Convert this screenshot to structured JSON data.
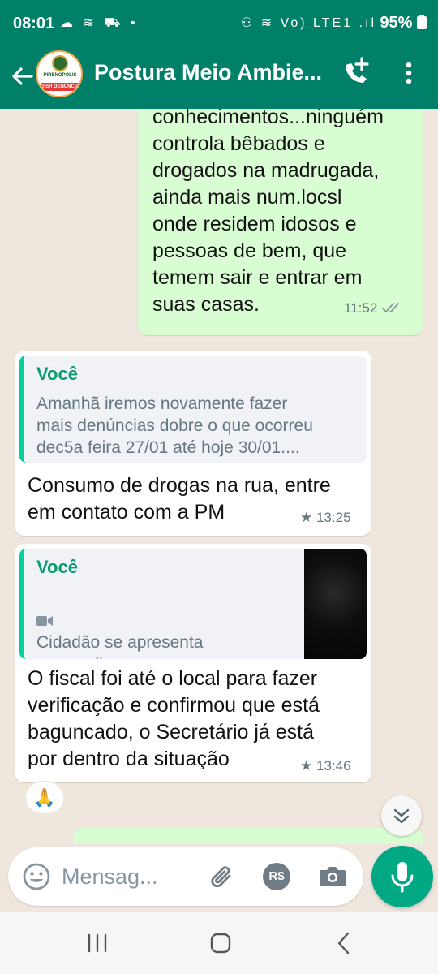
{
  "status_bar": {
    "time": "08:01",
    "left_icons": "☁ ≋ ⛟ •",
    "right_icons": "⚇ ≋ Vo) LTE1 .ıl",
    "battery": "95%"
  },
  "header": {
    "contact_name": "Postura Meio Ambie...",
    "avatar_city": "PIRENÓPOLIS",
    "avatar_badge": "DISH DENÚNCIA"
  },
  "messages": {
    "m1": {
      "text": "conhecimentos...ninguém\ncontrola bêbados e\ndrogados na madrugada,\nainda mais num.locsl\nonde residem idosos e\npessoas de bem, que\ntemem sair e entrar em\nsuas casas.",
      "time": "11:52",
      "status_icon": "double-check-icon"
    },
    "m2": {
      "quote_author": "Você",
      "quote_text": "Amanhã iremos novamente fazer\nmais denúncias dobre o que ocorreu\ndec5a feira 27/01 até hoje 30/01....",
      "text": "Consumo de drogas na rua, entre\nem contato com a PM",
      "time": "13:25",
      "starred": "★"
    },
    "m3": {
      "quote_author": "Você",
      "quote_text": "Cidadão se apresenta\npra medir o som, mas\npede pra todos sbaixarem ...",
      "text": "O fiscal foi até o local para fazer\nverificação e confirmou que está\nbaguncado, o Secretário já está\npor dentro da situação",
      "time": "13:46",
      "starred": "★"
    }
  },
  "reaction": "🙏",
  "input": {
    "placeholder": "Mensag..."
  },
  "pay_label": "R$",
  "colors": {
    "header": "#008069",
    "accent": "#00a884",
    "outgoing_bubble": "#d9fdd3",
    "incoming_bubble": "#ffffff",
    "chat_bg": "#efe7de"
  }
}
